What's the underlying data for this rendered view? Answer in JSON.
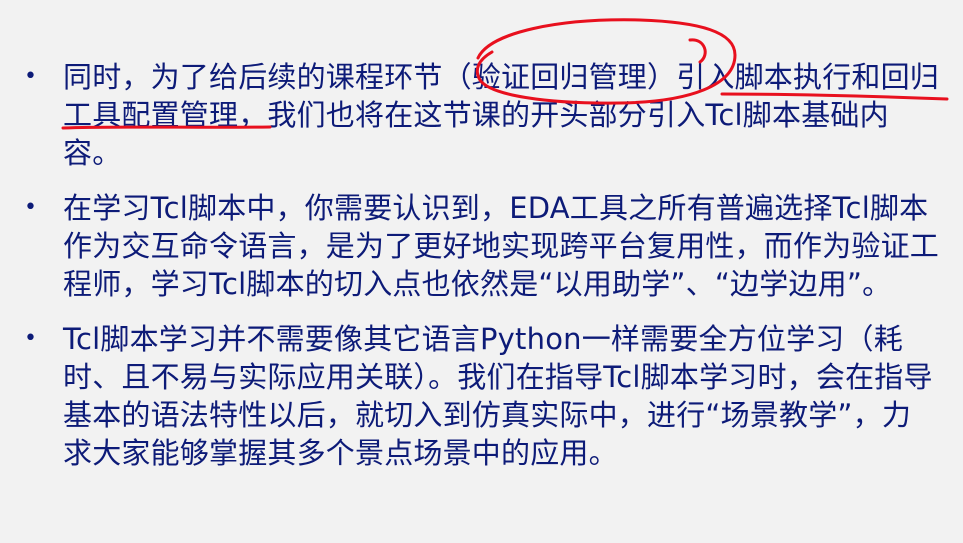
{
  "slide": {
    "bullets": [
      {
        "text": "同时，为了给后续的课程环节（验证回归管理）引入脚本执行和回归工具配置管理，我们也将在这节课的开头部分引入Tcl脚本基础内容。"
      },
      {
        "text": "在学习Tcl脚本中，你需要认识到，EDA工具之所有普遍选择Tcl脚本作为交互命令语言，是为了更好地实现跨平台复用性，而作为验证工程师，学习Tcl脚本的切入点也依然是“以用助学”、“边学边用”。"
      },
      {
        "text": "Tcl脚本学习并不需要像其它语言Python一样需要全方位学习（耗时、且不易与实际应用关联）。我们在指导Tcl脚本学习时，会在指导基本的语法特性以后，就切入到仿真实际中，进行“场景教学”，力求大家能够掌握其多个景点场景中的应用。"
      }
    ],
    "bullet_symbol": "•",
    "colors": {
      "background": "#f2f2f2",
      "text": "#0d1b78",
      "annotation": "#e8101e"
    }
  }
}
